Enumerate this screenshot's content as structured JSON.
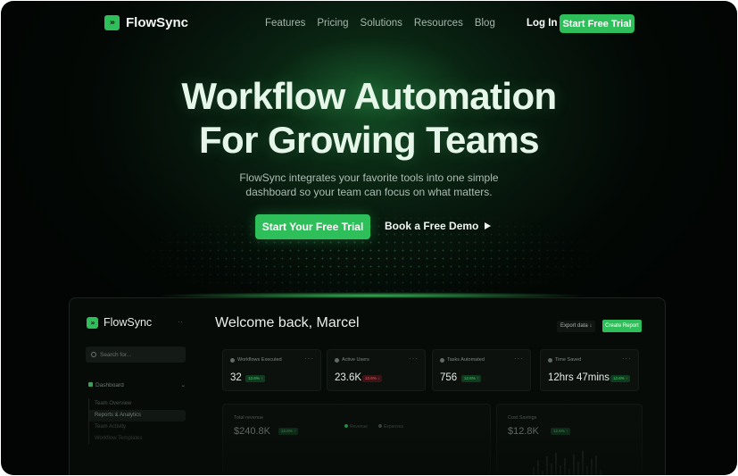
{
  "brand": {
    "name": "FlowSync",
    "logo_icon": "double-chevron-icon",
    "accent": "#2fbf5a"
  },
  "nav": {
    "links": [
      "Features",
      "Pricing",
      "Solutions",
      "Resources",
      "Blog"
    ],
    "login": "Log In",
    "cta": "Start Free Trial"
  },
  "hero": {
    "title_line1": "Workflow Automation",
    "title_line2": "For Growing Teams",
    "subtitle_line1": "FlowSync integrates your favorite tools into one simple",
    "subtitle_line2": "dashboard so your team can focus on what matters.",
    "primary_cta": "Start Your Free Trial",
    "secondary_cta": "Book a Free Demo"
  },
  "dashboard": {
    "brand": "FlowSync",
    "collapse_icon": "··",
    "search_placeholder": "Search for...",
    "nav_section": "Dashboard",
    "nav_items": [
      "Team Overview",
      "Reports & Analytics",
      "Team Activity",
      "Workflow Templates"
    ],
    "welcome": "Welcome back, Marcel",
    "export_label": "Export data ↓",
    "create_report_label": "Create Report",
    "cards": [
      {
        "label": "Workflows Executed",
        "value": "32",
        "badge": "12.6% ↑",
        "trend": "up"
      },
      {
        "label": "Active Users",
        "value": "23.6K",
        "badge": "12.6% ↓",
        "trend": "down"
      },
      {
        "label": "Tasks Automated",
        "value": "756",
        "badge": "12.6% ↑",
        "trend": "up"
      },
      {
        "label": "Time Saved",
        "value": "12hrs 47mins",
        "badge": "12.6% ↑",
        "trend": "up"
      }
    ],
    "revenue": {
      "title": "Total revenue",
      "value": "$240.8K",
      "badge": "12.6% ↑",
      "legend": [
        "Revenue",
        "Expenses"
      ]
    },
    "cost": {
      "title": "Cost Savings",
      "value": "$12.8K",
      "badge": "12.6% ↑"
    }
  }
}
